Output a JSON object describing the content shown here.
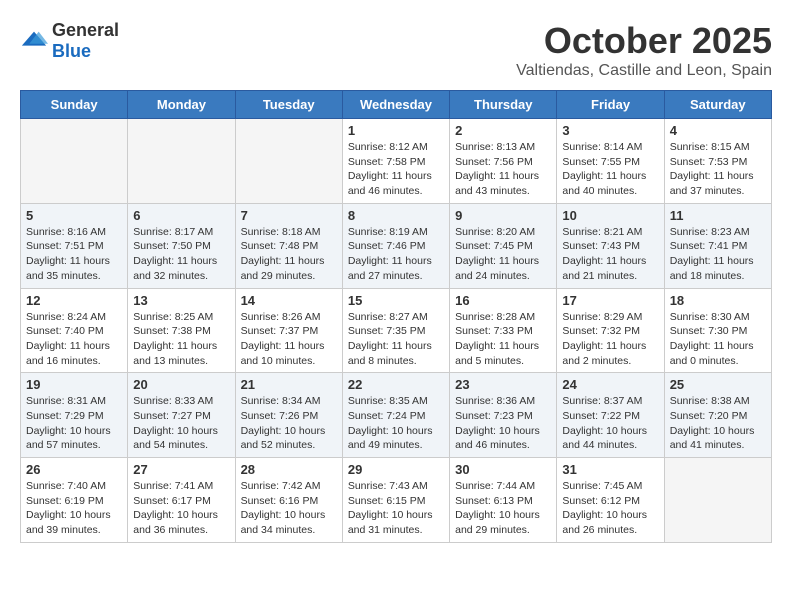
{
  "logo": {
    "general": "General",
    "blue": "Blue"
  },
  "header": {
    "month": "October 2025",
    "location": "Valtiendas, Castille and Leon, Spain"
  },
  "weekdays": [
    "Sunday",
    "Monday",
    "Tuesday",
    "Wednesday",
    "Thursday",
    "Friday",
    "Saturday"
  ],
  "weeks": [
    [
      {
        "day": "",
        "info": ""
      },
      {
        "day": "",
        "info": ""
      },
      {
        "day": "",
        "info": ""
      },
      {
        "day": "1",
        "info": "Sunrise: 8:12 AM\nSunset: 7:58 PM\nDaylight: 11 hours and 46 minutes."
      },
      {
        "day": "2",
        "info": "Sunrise: 8:13 AM\nSunset: 7:56 PM\nDaylight: 11 hours and 43 minutes."
      },
      {
        "day": "3",
        "info": "Sunrise: 8:14 AM\nSunset: 7:55 PM\nDaylight: 11 hours and 40 minutes."
      },
      {
        "day": "4",
        "info": "Sunrise: 8:15 AM\nSunset: 7:53 PM\nDaylight: 11 hours and 37 minutes."
      }
    ],
    [
      {
        "day": "5",
        "info": "Sunrise: 8:16 AM\nSunset: 7:51 PM\nDaylight: 11 hours and 35 minutes."
      },
      {
        "day": "6",
        "info": "Sunrise: 8:17 AM\nSunset: 7:50 PM\nDaylight: 11 hours and 32 minutes."
      },
      {
        "day": "7",
        "info": "Sunrise: 8:18 AM\nSunset: 7:48 PM\nDaylight: 11 hours and 29 minutes."
      },
      {
        "day": "8",
        "info": "Sunrise: 8:19 AM\nSunset: 7:46 PM\nDaylight: 11 hours and 27 minutes."
      },
      {
        "day": "9",
        "info": "Sunrise: 8:20 AM\nSunset: 7:45 PM\nDaylight: 11 hours and 24 minutes."
      },
      {
        "day": "10",
        "info": "Sunrise: 8:21 AM\nSunset: 7:43 PM\nDaylight: 11 hours and 21 minutes."
      },
      {
        "day": "11",
        "info": "Sunrise: 8:23 AM\nSunset: 7:41 PM\nDaylight: 11 hours and 18 minutes."
      }
    ],
    [
      {
        "day": "12",
        "info": "Sunrise: 8:24 AM\nSunset: 7:40 PM\nDaylight: 11 hours and 16 minutes."
      },
      {
        "day": "13",
        "info": "Sunrise: 8:25 AM\nSunset: 7:38 PM\nDaylight: 11 hours and 13 minutes."
      },
      {
        "day": "14",
        "info": "Sunrise: 8:26 AM\nSunset: 7:37 PM\nDaylight: 11 hours and 10 minutes."
      },
      {
        "day": "15",
        "info": "Sunrise: 8:27 AM\nSunset: 7:35 PM\nDaylight: 11 hours and 8 minutes."
      },
      {
        "day": "16",
        "info": "Sunrise: 8:28 AM\nSunset: 7:33 PM\nDaylight: 11 hours and 5 minutes."
      },
      {
        "day": "17",
        "info": "Sunrise: 8:29 AM\nSunset: 7:32 PM\nDaylight: 11 hours and 2 minutes."
      },
      {
        "day": "18",
        "info": "Sunrise: 8:30 AM\nSunset: 7:30 PM\nDaylight: 11 hours and 0 minutes."
      }
    ],
    [
      {
        "day": "19",
        "info": "Sunrise: 8:31 AM\nSunset: 7:29 PM\nDaylight: 10 hours and 57 minutes."
      },
      {
        "day": "20",
        "info": "Sunrise: 8:33 AM\nSunset: 7:27 PM\nDaylight: 10 hours and 54 minutes."
      },
      {
        "day": "21",
        "info": "Sunrise: 8:34 AM\nSunset: 7:26 PM\nDaylight: 10 hours and 52 minutes."
      },
      {
        "day": "22",
        "info": "Sunrise: 8:35 AM\nSunset: 7:24 PM\nDaylight: 10 hours and 49 minutes."
      },
      {
        "day": "23",
        "info": "Sunrise: 8:36 AM\nSunset: 7:23 PM\nDaylight: 10 hours and 46 minutes."
      },
      {
        "day": "24",
        "info": "Sunrise: 8:37 AM\nSunset: 7:22 PM\nDaylight: 10 hours and 44 minutes."
      },
      {
        "day": "25",
        "info": "Sunrise: 8:38 AM\nSunset: 7:20 PM\nDaylight: 10 hours and 41 minutes."
      }
    ],
    [
      {
        "day": "26",
        "info": "Sunrise: 7:40 AM\nSunset: 6:19 PM\nDaylight: 10 hours and 39 minutes."
      },
      {
        "day": "27",
        "info": "Sunrise: 7:41 AM\nSunset: 6:17 PM\nDaylight: 10 hours and 36 minutes."
      },
      {
        "day": "28",
        "info": "Sunrise: 7:42 AM\nSunset: 6:16 PM\nDaylight: 10 hours and 34 minutes."
      },
      {
        "day": "29",
        "info": "Sunrise: 7:43 AM\nSunset: 6:15 PM\nDaylight: 10 hours and 31 minutes."
      },
      {
        "day": "30",
        "info": "Sunrise: 7:44 AM\nSunset: 6:13 PM\nDaylight: 10 hours and 29 minutes."
      },
      {
        "day": "31",
        "info": "Sunrise: 7:45 AM\nSunset: 6:12 PM\nDaylight: 10 hours and 26 minutes."
      },
      {
        "day": "",
        "info": ""
      }
    ]
  ]
}
